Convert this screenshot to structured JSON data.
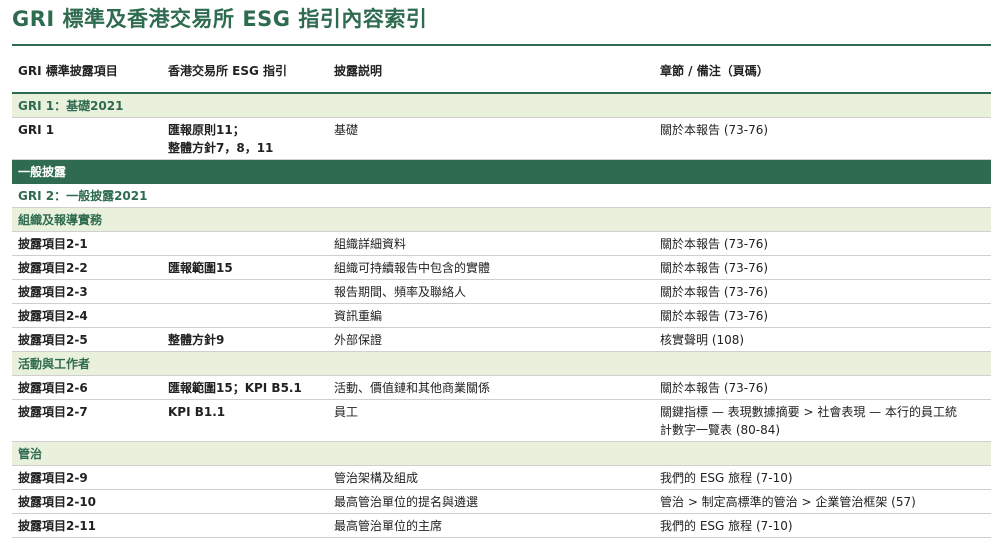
{
  "page_title": "GRI 標準及香港交易所 ESG 指引內容索引",
  "header": {
    "col1": "GRI 標準披露項目",
    "col2": "香港交易所 ESG 指引",
    "col3": "披露説明",
    "col4": "章節 / 備注（頁碼）"
  },
  "rows": [
    {
      "kind": "band",
      "label": "GRI 1：基礎2021"
    },
    {
      "kind": "data",
      "c1": "GRI 1",
      "c2": [
        "匯報原則11；",
        "整體方針7，8，11"
      ],
      "c3": "基礎",
      "c4": [
        "關於本報告 (73-76)"
      ]
    },
    {
      "kind": "dark",
      "label": "一般披露"
    },
    {
      "kind": "plain",
      "label": "GRI 2：一般披露2021"
    },
    {
      "kind": "band",
      "label": "組織及報導實務"
    },
    {
      "kind": "data",
      "c1": "披露項目2-1",
      "c2": [
        ""
      ],
      "c3": "組織詳細資料",
      "c4": [
        "關於本報告 (73-76)"
      ]
    },
    {
      "kind": "data",
      "c1": "披露項目2-2",
      "c2": [
        "匯報範圍15"
      ],
      "c3": "組織可持續報告中包含的實體",
      "c4": [
        "關於本報告 (73-76)"
      ]
    },
    {
      "kind": "data",
      "c1": "披露項目2-3",
      "c2": [
        ""
      ],
      "c3": "報告期間、頻率及聯絡人",
      "c4": [
        "關於本報告 (73-76)"
      ]
    },
    {
      "kind": "data",
      "c1": "披露項目2-4",
      "c2": [
        ""
      ],
      "c3": "資訊重編",
      "c4": [
        "關於本報告 (73-76)"
      ]
    },
    {
      "kind": "data",
      "c1": "披露項目2-5",
      "c2": [
        "整體方針9"
      ],
      "c3": "外部保證",
      "c4": [
        "核實聲明 (108)"
      ]
    },
    {
      "kind": "band",
      "label": "活動與工作者"
    },
    {
      "kind": "data",
      "c1": "披露項目2-6",
      "c2": [
        "匯報範圍15；KPI B5.1"
      ],
      "c3": "活動、價值鏈和其他商業關係",
      "c4": [
        "關於本報告 (73-76)"
      ]
    },
    {
      "kind": "data",
      "c1": "披露項目2-7",
      "c2": [
        "KPI B1.1"
      ],
      "c3": "員工",
      "c4": [
        "關鍵指標 — 表現數據摘要 > 社會表現 — 本行的員工統",
        "計數字一覽表 (80-84)"
      ]
    },
    {
      "kind": "band",
      "label": "管治"
    },
    {
      "kind": "data",
      "c1": "披露項目2-9",
      "c2": [
        ""
      ],
      "c3": "管治架構及組成",
      "c4": [
        "我們的 ESG 旅程 (7-10)"
      ]
    },
    {
      "kind": "data",
      "c1": "披露項目2-10",
      "c2": [
        ""
      ],
      "c3": "最高管治單位的提名與遴選",
      "c4": [
        "管治 > 制定高標準的管治 > 企業管治框架 (57)"
      ]
    },
    {
      "kind": "data",
      "c1": "披露項目2-11",
      "c2": [
        ""
      ],
      "c3": "最高管治單位的主席",
      "c4": [
        "我們的 ESG 旅程 (7-10)"
      ]
    }
  ]
}
